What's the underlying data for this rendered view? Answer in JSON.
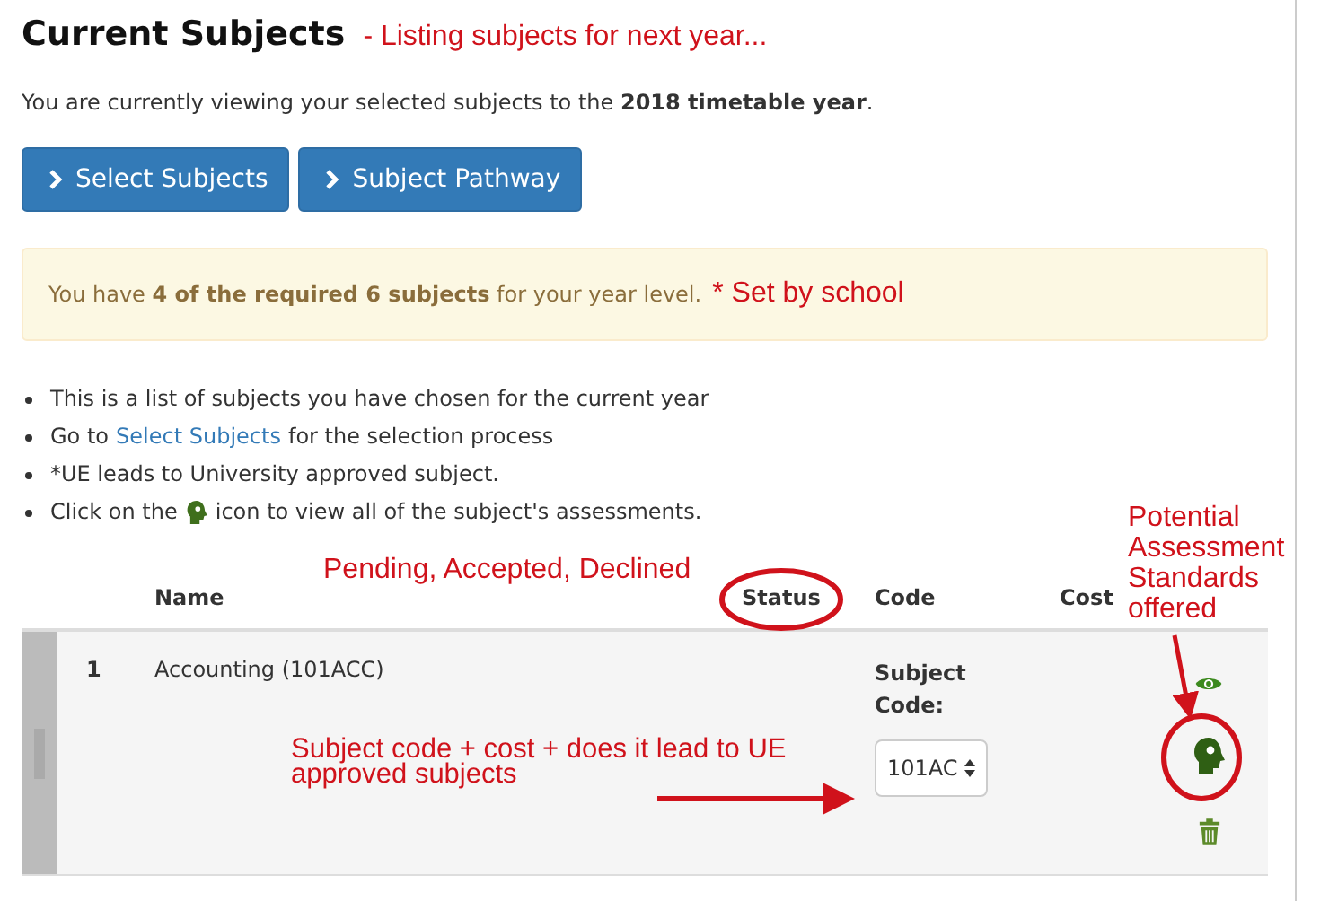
{
  "title": "Current Subjects",
  "title_note": "- Listing subjects for next year...",
  "intro": "You are currently viewing your selected subjects to the **2018 timetable year**.",
  "buttons": [
    {
      "label": "Select Subjects"
    },
    {
      "label": "Subject Pathway"
    }
  ],
  "alert": {
    "text": "You have **4 of the required 6 subjects** for your year level.",
    "note": "* Set by school"
  },
  "bullets": [
    {
      "kind": "text",
      "text": "This is a list of subjects you have chosen for the current year"
    },
    {
      "kind": "link",
      "before": "Go to",
      "link": "Select Subjects",
      "after": "for the selection process"
    },
    {
      "kind": "text",
      "text": "*UE leads to University approved subject."
    },
    {
      "kind": "icon",
      "before": "Click on the",
      "after": "icon to view all of the subject's assessments."
    }
  ],
  "table": {
    "columns": [
      "Name",
      "Status",
      "Code",
      "Cost"
    ],
    "rows": [
      {
        "number": "1",
        "name": "Accounting (101ACC)",
        "code_label": "Subject Code:",
        "code_value": "101AC"
      }
    ]
  },
  "annotations": [
    {
      "kind": "status",
      "text": "Pending, Accepted, Declined"
    },
    {
      "kind": "assessment",
      "text": "Potential Assessment Standards offered"
    },
    {
      "kind": "code",
      "text": "Subject code + cost + does it lead to UE approved subjects"
    }
  ]
}
